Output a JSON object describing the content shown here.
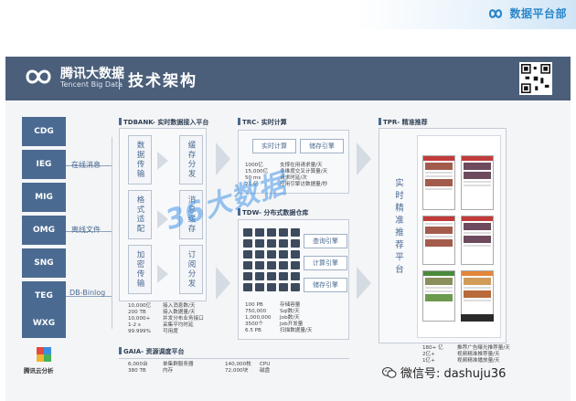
{
  "brand_top": {
    "name": "数据平台部"
  },
  "header": {
    "logo_cn": "腾讯大数据",
    "logo_en": "Tencent Big Data",
    "title": "技术架构"
  },
  "sources": [
    "CDG",
    "IEG",
    "MIG",
    "OMG",
    "SNG",
    "TEG",
    "WXG"
  ],
  "source_footer": {
    "logo_text": "腾讯云分析"
  },
  "flows": [
    "在线消息",
    "离线文件",
    "DB-Binlog"
  ],
  "tdbank": {
    "title": "TDBANK- 实时数据接入平台",
    "col1": [
      "数据传输",
      "格式适配",
      "加密传输"
    ],
    "col2": [
      "缓存分发",
      "消息缓存",
      "订阅分发"
    ],
    "stats": [
      [
        "10,000亿",
        "接入消息数/天"
      ],
      [
        "200 TB",
        "接入数据量/天"
      ],
      [
        "10,000+",
        "并发分布业务接口"
      ],
      [
        "1-2 s",
        "采集平均时延"
      ],
      [
        "99.999%",
        "可用度"
      ]
    ]
  },
  "trc": {
    "title": "TRC- 实时计算",
    "engines": [
      "实时计算",
      "储存引擎"
    ],
    "stats": [
      [
        "1000亿",
        "支撑在用请求量/天"
      ],
      [
        "15,000亿",
        "多维度交叉计算量/天"
      ],
      [
        "50 ms",
        "请求时延/次"
      ],
      [
        "21 亿",
        "应用引擎访数据量/秒"
      ]
    ]
  },
  "tdw": {
    "title": "TDW- 分布式数据仓库",
    "engines": [
      "查询引擎",
      "计算引擎",
      "储存引擎"
    ],
    "stats": [
      [
        "100 PB",
        "存储容量"
      ],
      [
        "750,000",
        "Sql数/天"
      ],
      [
        "1,000,000",
        "Job数/天"
      ],
      [
        "3500个",
        "Job开发量"
      ],
      [
        "6.5 PB",
        "扫描数据量/天"
      ]
    ]
  },
  "tpr": {
    "title": "TPR- 精准推荐",
    "vertical": "实时精准推荐平台",
    "stats": [
      [
        "180+ 亿",
        "推荐广告曝光推荐量/天"
      ],
      [
        "2亿+",
        "视频精准推荐量/天"
      ],
      [
        "1亿+",
        "视频精准播放量/天"
      ]
    ]
  },
  "gaia": {
    "title": "GAIA- 资源调度平台",
    "stats": [
      [
        "6,000台",
        "单集群服务器"
      ],
      [
        "380 TB",
        "内存"
      ],
      [
        "140,000核",
        "CPU"
      ],
      [
        "72,000块",
        "磁盘"
      ]
    ]
  },
  "watermark": "36大数据",
  "wechat": {
    "label": "微信号: dashuju36"
  },
  "colors": {
    "accent": "#4b6a91",
    "header": "#4b5f7a",
    "brand": "#2a86c9"
  }
}
